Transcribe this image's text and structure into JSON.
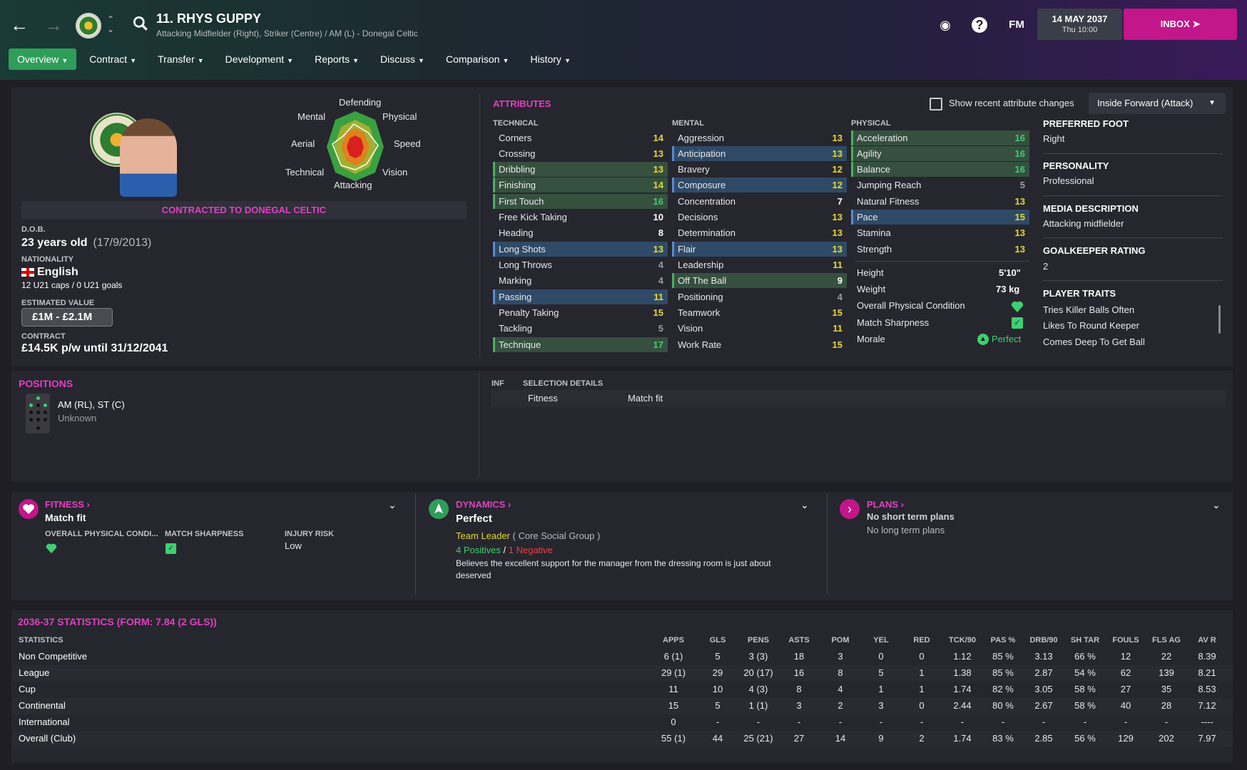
{
  "header": {
    "player_name": "11. RHYS GUPPY",
    "subtitle": "Attacking Midfielder (Right), Striker (Centre) / AM (L) - Donegal Celtic",
    "date": "14 MAY 2037",
    "time": "Thu 10:00",
    "inbox_label": "INBOX",
    "fm_label": "FM"
  },
  "tabs": [
    {
      "label": "Overview"
    },
    {
      "label": "Contract"
    },
    {
      "label": "Transfer"
    },
    {
      "label": "Development"
    },
    {
      "label": "Reports"
    },
    {
      "label": "Discuss"
    },
    {
      "label": "Comparison"
    },
    {
      "label": "History"
    }
  ],
  "profile": {
    "radar_labels": {
      "defending": "Defending",
      "physical": "Physical",
      "speed": "Speed",
      "vision": "Vision",
      "attacking": "Attacking",
      "technical": "Technical",
      "aerial": "Aerial",
      "mental": "Mental"
    },
    "contracted_to": "CONTRACTED TO DONEGAL CELTIC",
    "dob_label": "D.O.B.",
    "age": "23 years old",
    "dob": "(17/9/2013)",
    "nationality_label": "NATIONALITY",
    "nationality": "English",
    "caps": "12 U21 caps / 0 U21 goals",
    "value_label": "ESTIMATED VALUE",
    "value": "£1M - £2.1M",
    "contract_label": "CONTRACT",
    "contract": "£14.5K p/w until 31/12/2041"
  },
  "attributes": {
    "title": "ATTRIBUTES",
    "show_changes": "Show recent attribute changes",
    "role": "Inside Forward (Attack)",
    "technical_label": "TECHNICAL",
    "mental_label": "MENTAL",
    "physical_label": "PHYSICAL",
    "technical": [
      {
        "name": "Corners",
        "value": "14"
      },
      {
        "name": "Crossing",
        "value": "13"
      },
      {
        "name": "Dribbling",
        "value": "13"
      },
      {
        "name": "Finishing",
        "value": "14"
      },
      {
        "name": "First Touch",
        "value": "16"
      },
      {
        "name": "Free Kick Taking",
        "value": "10"
      },
      {
        "name": "Heading",
        "value": "8"
      },
      {
        "name": "Long Shots",
        "value": "13"
      },
      {
        "name": "Long Throws",
        "value": "4"
      },
      {
        "name": "Marking",
        "value": "4"
      },
      {
        "name": "Passing",
        "value": "11"
      },
      {
        "name": "Penalty Taking",
        "value": "15"
      },
      {
        "name": "Tackling",
        "value": "5"
      },
      {
        "name": "Technique",
        "value": "17"
      }
    ],
    "mental": [
      {
        "name": "Aggression",
        "value": "13"
      },
      {
        "name": "Anticipation",
        "value": "13"
      },
      {
        "name": "Bravery",
        "value": "12"
      },
      {
        "name": "Composure",
        "value": "12"
      },
      {
        "name": "Concentration",
        "value": "7"
      },
      {
        "name": "Decisions",
        "value": "13"
      },
      {
        "name": "Determination",
        "value": "13"
      },
      {
        "name": "Flair",
        "value": "13"
      },
      {
        "name": "Leadership",
        "value": "11"
      },
      {
        "name": "Off The Ball",
        "value": "9"
      },
      {
        "name": "Positioning",
        "value": "4"
      },
      {
        "name": "Teamwork",
        "value": "15"
      },
      {
        "name": "Vision",
        "value": "11"
      },
      {
        "name": "Work Rate",
        "value": "15"
      }
    ],
    "physical": [
      {
        "name": "Acceleration",
        "value": "16"
      },
      {
        "name": "Agility",
        "value": "16"
      },
      {
        "name": "Balance",
        "value": "16"
      },
      {
        "name": "Jumping Reach",
        "value": "5"
      },
      {
        "name": "Natural Fitness",
        "value": "13"
      },
      {
        "name": "Pace",
        "value": "15"
      },
      {
        "name": "Stamina",
        "value": "13"
      },
      {
        "name": "Strength",
        "value": "13"
      }
    ],
    "height_label": "Height",
    "height": "5'10\"",
    "weight_label": "Weight",
    "weight": "73 kg",
    "condition_label": "Overall Physical Condition",
    "sharpness_label": "Match Sharpness",
    "morale_label": "Morale",
    "morale": "Perfect"
  },
  "side_info": {
    "foot_label": "PREFERRED FOOT",
    "foot": "Right",
    "personality_label": "PERSONALITY",
    "personality": "Professional",
    "media_label": "MEDIA DESCRIPTION",
    "media": "Attacking midfielder",
    "gk_label": "GOALKEEPER RATING",
    "gk": "2",
    "traits_label": "PLAYER TRAITS",
    "traits": [
      "Tries Killer Balls Often",
      "Likes To Round Keeper",
      "Comes Deep To Get Ball"
    ]
  },
  "positions": {
    "title": "POSITIONS",
    "positions": "AM (RL), ST (C)",
    "familiarity": "Unknown",
    "inf_label": "INF",
    "selection_label": "SELECTION DETAILS",
    "fitness_label": "Fitness",
    "fitness_value": "Match fit"
  },
  "cards": {
    "fitness_title": "FITNESS",
    "fitness_value": "Match fit",
    "opc_label": "OVERALL PHYSICAL CONDI...",
    "sharp_label": "MATCH SHARPNESS",
    "injury_label": "INJURY RISK",
    "injury_value": "Low",
    "dynamics_title": "DYNAMICS",
    "dynamics_value": "Perfect",
    "group_role": "Team Leader",
    "group_name": "( Core Social Group )",
    "positives": "4 Positives",
    "slash": "/",
    "negatives": "1 Negative",
    "dyn_desc": "Believes the excellent support for the manager from the dressing room is just about deserved",
    "plans_title": "PLANS",
    "plans_short": "No short term plans",
    "plans_long": "No long term plans"
  },
  "stats": {
    "title": "2036-37 STATISTICS (FORM: 7.84 (2 GLS))",
    "label_header": "STATISTICS",
    "headers": [
      "APPS",
      "GLS",
      "PENS",
      "ASTS",
      "POM",
      "YEL",
      "RED",
      "TCK/90",
      "PAS %",
      "DRB/90",
      "SH TAR",
      "FOULS",
      "FLS AG",
      "AV R"
    ],
    "rows": [
      {
        "label": "Non Competitive",
        "cells": [
          "6 (1)",
          "5",
          "3 (3)",
          "18",
          "3",
          "0",
          "0",
          "1.12",
          "85 %",
          "3.13",
          "66 %",
          "12",
          "22",
          "8.39"
        ]
      },
      {
        "label": "League",
        "cells": [
          "29 (1)",
          "29",
          "20 (17)",
          "16",
          "8",
          "5",
          "1",
          "1.38",
          "85 %",
          "2.87",
          "54 %",
          "62",
          "139",
          "8.21"
        ]
      },
      {
        "label": "Cup",
        "cells": [
          "11",
          "10",
          "4 (3)",
          "8",
          "4",
          "1",
          "1",
          "1.74",
          "82 %",
          "3.05",
          "58 %",
          "27",
          "35",
          "8.53"
        ]
      },
      {
        "label": "Continental",
        "cells": [
          "15",
          "5",
          "1 (1)",
          "3",
          "2",
          "3",
          "0",
          "2.44",
          "80 %",
          "2.67",
          "58 %",
          "40",
          "28",
          "7.12"
        ]
      },
      {
        "label": "International",
        "cells": [
          "0",
          "-",
          "-",
          "-",
          "-",
          "-",
          "-",
          "-",
          "-",
          "-",
          "-",
          "-",
          "-",
          "----"
        ]
      },
      {
        "label": "Overall (Club)",
        "cells": [
          "55 (1)",
          "44",
          "25 (21)",
          "27",
          "14",
          "9",
          "2",
          "1.74",
          "83 %",
          "2.85",
          "56 %",
          "129",
          "202",
          "7.97"
        ]
      }
    ]
  }
}
